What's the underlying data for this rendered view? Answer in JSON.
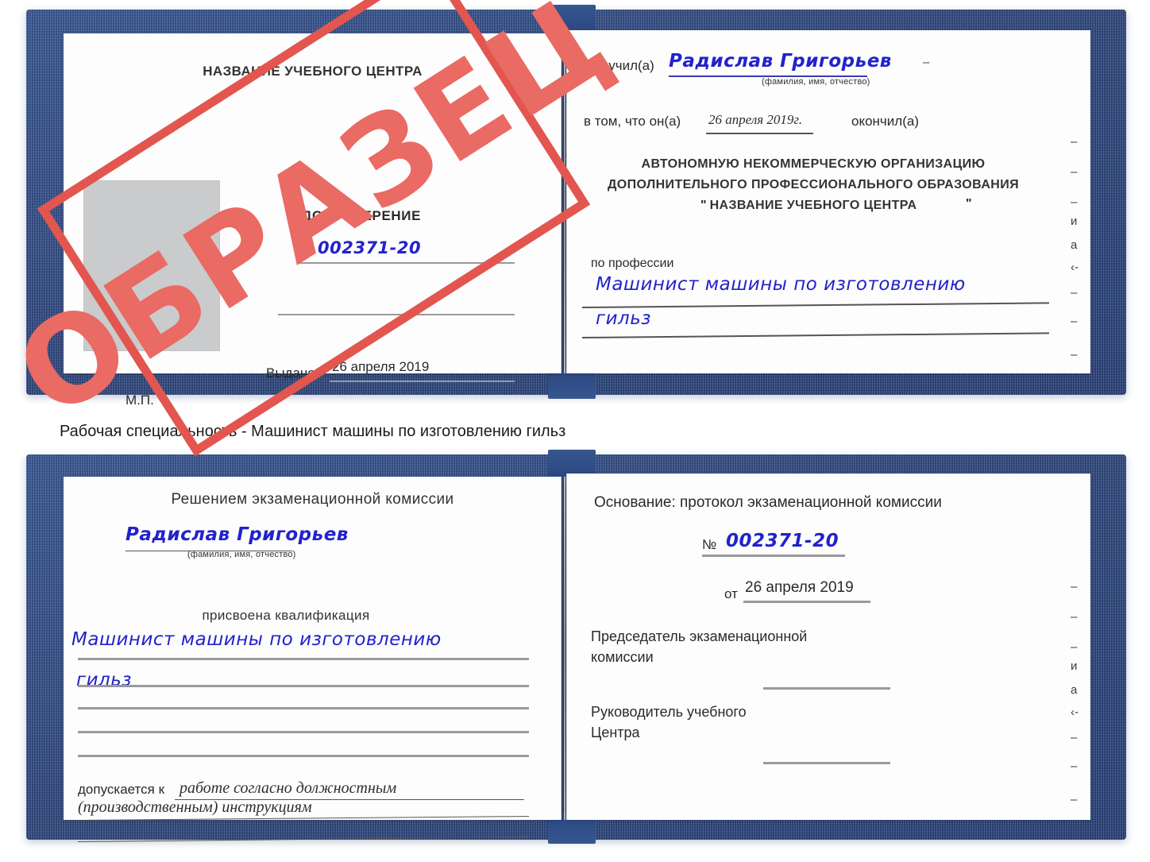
{
  "caption": "Рабочая специальность - Машинист машины по изготовлению гильз",
  "stamp": {
    "label": "ОБРАЗЕЦ",
    "color": "#e2564f"
  },
  "colors": {
    "cover_blue": "#2c4783",
    "handwriting_blue": "#2222cc",
    "stamp_red": "#e2564f",
    "photo_gray": "#c9cbcc"
  },
  "certificate_1": {
    "left_page": {
      "org_title": "НАЗВАНИЕ УЧЕБНОГО ЦЕНТРА",
      "doc_type": "УДОСТОВЕРЕНИЕ",
      "number_symbol": "№",
      "number_value": "002371-20",
      "issued_label": "Выдано",
      "issued_value": "26 апреля 2019",
      "seal_label": "М.П."
    },
    "right_page": {
      "received_label": "Получил(а)",
      "received_value": "Радислав Григорьев",
      "name_hint": "(фамилия, имя, отчество)",
      "that_he_label": "в том, что он(а)",
      "completion_date": "26 апреля 2019г.",
      "finished_label": "окончил(а)",
      "org_line_1": "АВТОНОМНУЮ НЕКОММЕРЧЕСКУЮ ОРГАНИЗАЦИЮ",
      "org_line_2": "ДОПОЛНИТЕЛЬНОГО ПРОФЕССИОНАЛЬНОГО ОБРАЗОВАНИЯ",
      "org_quote_open": "\"",
      "org_line_3": "НАЗВАНИЕ УЧЕБНОГО ЦЕНТРА",
      "org_quote_close": "\"",
      "profession_label": "по профессии",
      "profession_value_1": "Машинист машины по изготовлению",
      "profession_value_2": "гильз"
    },
    "edge_fragments": [
      "–",
      "–",
      "–",
      "и",
      "а",
      "‹-",
      "–",
      "–",
      "–"
    ]
  },
  "certificate_2": {
    "left_page": {
      "decision_title": "Решением экзаменационной комиссии",
      "name_value": "Радислав Григорьев",
      "name_hint": "(фамилия, имя, отчество)",
      "qualification_label": "присвоена квалификация",
      "qualification_value_1": "Машинист машины по изготовлению",
      "qualification_value_2": "гильз",
      "allowed_label": "допускается к",
      "allowed_value_1": "работе согласно должностным",
      "allowed_value_2": "(производственным) инструкциям"
    },
    "right_page": {
      "basis_label": "Основание: протокол экзаменационной комиссии",
      "number_symbol": "№",
      "number_value": "002371-20",
      "from_label": "от",
      "from_value": "26 апреля 2019",
      "chairman_line_1": "Председатель экзаменационной",
      "chairman_line_2": "комиссии",
      "head_line_1": "Руководитель учебного",
      "head_line_2": "Центра"
    },
    "edge_fragments": [
      "–",
      "–",
      "–",
      "и",
      "а",
      "‹-",
      "–",
      "–",
      "–"
    ]
  }
}
